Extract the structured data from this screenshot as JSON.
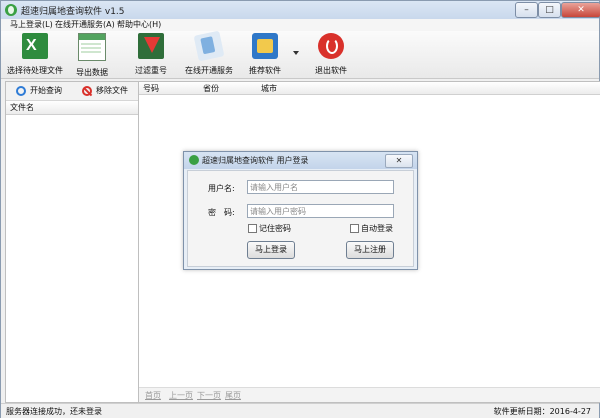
{
  "window": {
    "title": "超速归属地查询软件 v1.5",
    "controls": {
      "minimize": "–",
      "maximize": "□",
      "close": "✕"
    }
  },
  "menubar": {
    "items": [
      "马上登录(L)",
      "在线开通服务(A)",
      "帮助中心(H)"
    ]
  },
  "toolbar": {
    "items": [
      {
        "label": "选择待处理文件",
        "icon": "excel-file-icon"
      },
      {
        "label": "导出数据",
        "icon": "spreadsheet-export-icon"
      },
      {
        "label": "过滤重号",
        "icon": "filter-duplicates-icon"
      },
      {
        "label": "在线开通服务",
        "icon": "online-service-icon"
      },
      {
        "label": "推荐软件",
        "icon": "recommend-software-icon"
      },
      {
        "label": "退出软件",
        "icon": "power-exit-icon"
      }
    ]
  },
  "left_panel": {
    "start_query": "开始查询",
    "remove_file": "移除文件",
    "column_header": "文件名"
  },
  "main_table": {
    "columns": [
      "号码",
      "省份",
      "城市"
    ]
  },
  "pager": {
    "first": "首页",
    "prev": "上一页",
    "next": "下一页",
    "last": "尾页"
  },
  "statusbar": {
    "left": "服务器连接成功，还未登录",
    "right": "软件更新日期：2016-4-27"
  },
  "login_dialog": {
    "title": "超速归属地查询软件 用户登录",
    "close": "✕",
    "username_label": "用户名:",
    "username_placeholder": "请输入用户名",
    "password_label": "密　码:",
    "password_placeholder": "请输入用户密码",
    "remember_label": "记住密码",
    "auto_login_label": "自动登录",
    "login_button": "马上登录",
    "register_button": "马上注册"
  }
}
